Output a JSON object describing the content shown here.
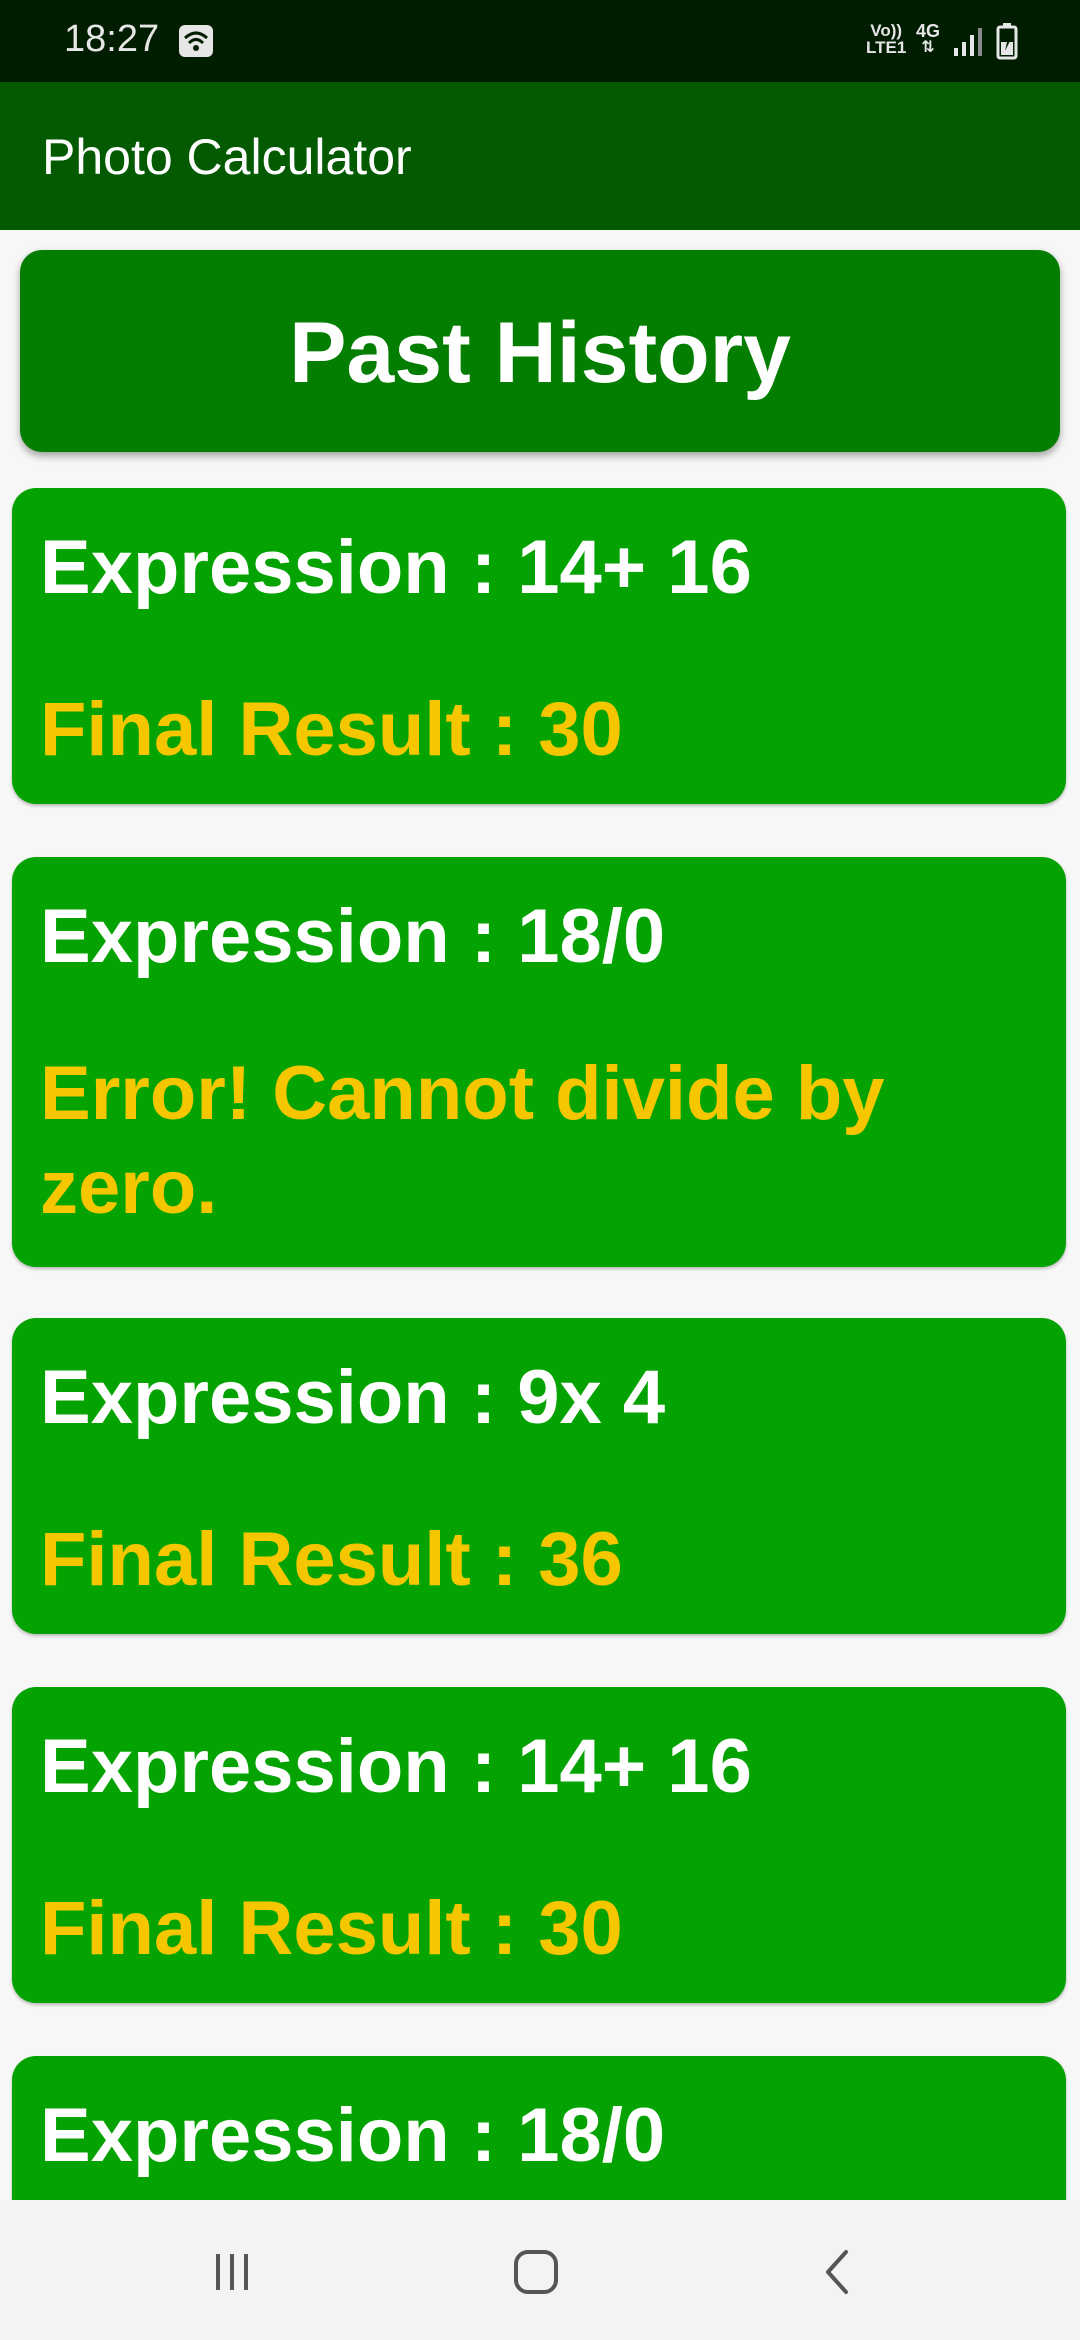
{
  "status_bar": {
    "time": "18:27",
    "volte_line1": "Vo))",
    "volte_line2": "LTE1",
    "network": "4G",
    "icons": [
      "wifi-icon",
      "signal-icon",
      "battery-charging-icon"
    ]
  },
  "app_bar": {
    "title": "Photo Calculator"
  },
  "history": {
    "title": "Past History",
    "items": [
      {
        "expression": "Expression : 14+ 16",
        "result": "Final Result : 30"
      },
      {
        "expression": "Expression : 18/0",
        "result": "Error! Cannot divide by zero."
      },
      {
        "expression": "Expression : 9x 4",
        "result": "Final Result : 36"
      },
      {
        "expression": "Expression : 14+ 16",
        "result": "Final Result : 30"
      },
      {
        "expression": "Expression : 18/0",
        "result": ""
      }
    ]
  },
  "nav_bar": {
    "icons": [
      "recent-apps-icon",
      "home-icon",
      "back-icon"
    ]
  },
  "colors": {
    "status_bar": "#011d00",
    "app_bar": "#035a00",
    "header_card": "#047e00",
    "card": "#05a302",
    "result_text": "#f6c700",
    "background": "#f7f7f7"
  }
}
